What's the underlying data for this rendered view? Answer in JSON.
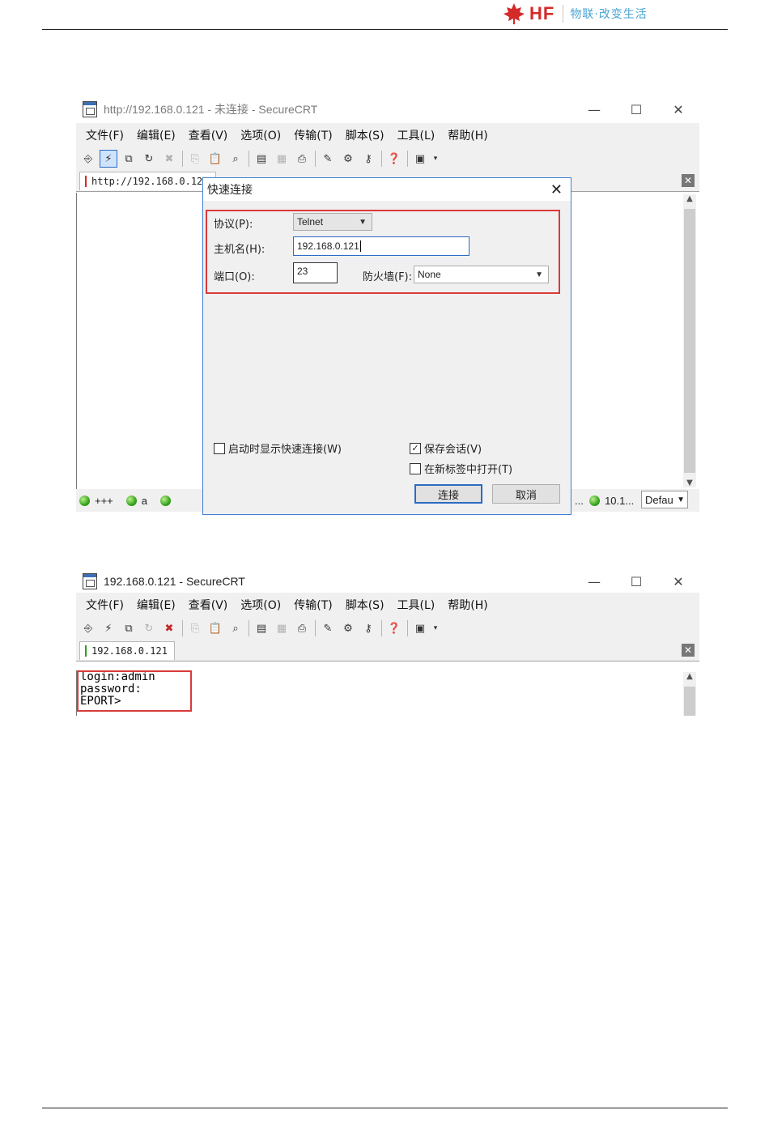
{
  "header": {
    "brand": "HF",
    "slogan": "物联·改变生活",
    "colors": {
      "brand_red": "#d42a2a",
      "slogan_blue": "#4aa3d6"
    }
  },
  "window1": {
    "title": "http://192.168.0.121 - 未连接 - SecureCRT",
    "controls": [
      "—",
      "☐",
      "✕"
    ],
    "menu": [
      "文件(F)",
      "编辑(E)",
      "查看(V)",
      "选项(O)",
      "传输(T)",
      "脚本(S)",
      "工具(L)",
      "帮助(H)"
    ],
    "tab_label": "http://192.168.0.121",
    "statusbar": [
      {
        "label": "+++"
      },
      {
        "label": "a"
      }
    ],
    "status_right_label": "10.1...",
    "session_select": "Defau",
    "dialog": {
      "title": "快速连接",
      "protocol_label": "协议(P):",
      "protocol_value": "Telnet",
      "hostname_label": "主机名(H):",
      "hostname_value": "192.168.0.121",
      "port_label": "端口(O):",
      "port_value": "23",
      "firewall_label": "防火墙(F):",
      "firewall_value": "None",
      "show_on_startup_label": "启动时显示快速连接(W)",
      "show_on_startup_checked": false,
      "save_session_label": "保存会话(V)",
      "save_session_checked": true,
      "open_in_tab_label": "在新标签中打开(T)",
      "open_in_tab_checked": false,
      "connect_button": "连接",
      "cancel_button": "取消"
    }
  },
  "window2": {
    "title": "192.168.0.121 - SecureCRT",
    "controls": [
      "—",
      "☐",
      "✕"
    ],
    "menu": [
      "文件(F)",
      "编辑(E)",
      "查看(V)",
      "选项(O)",
      "传输(T)",
      "脚本(S)",
      "工具(L)",
      "帮助(H)"
    ],
    "tab_label": "192.168.0.121",
    "terminal_lines": [
      "login:admin",
      "password:",
      "EPORT>"
    ]
  },
  "toolbar_icons": [
    "connect-icon",
    "quick-connect-icon",
    "connect-in-tab-icon",
    "reconnect-icon",
    "disconnect-icon",
    "copy-icon",
    "paste-icon",
    "find-icon",
    "print-screen-icon",
    "print-selection-icon",
    "print-icon",
    "session-options-icon",
    "global-options-icon",
    "keymap-icon",
    "help-icon",
    "sftp-icon"
  ],
  "colors": {
    "highlight_red": "#d93a3a",
    "accent_blue": "#2b6cc4"
  }
}
